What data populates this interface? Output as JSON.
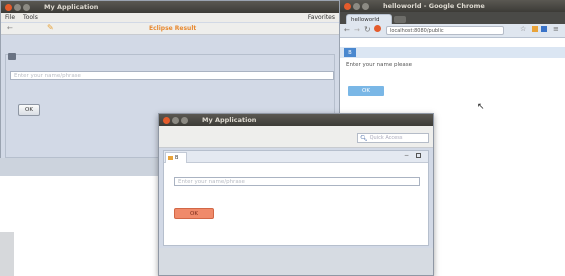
{
  "left_window": {
    "title": "My Application",
    "menu": [
      "File",
      "Tools"
    ],
    "favorites_label": "Favorites",
    "heading": "Eclipse Result",
    "input_placeholder": "Enter your name/phrase",
    "ok_label": "OK"
  },
  "chrome_window": {
    "title": "helloworld - Google Chrome",
    "tab_label": "helloworld",
    "url": "localhost:8080/public",
    "page_tab_label": "B",
    "prompt_text": "Enter your name please",
    "button_label": "OK"
  },
  "front_window": {
    "title": "My Application",
    "search_placeholder": "Quick Access",
    "tab_label": "B",
    "input_placeholder": "Enter your name/phrase",
    "ok_label": "OK"
  },
  "colors": {
    "titlebar": "#3c3b37",
    "close_button": "#e45b2b",
    "panel": "#d2d9e6",
    "orange_button": "#f08a6a",
    "chrome_button": "#7ab7e6"
  }
}
